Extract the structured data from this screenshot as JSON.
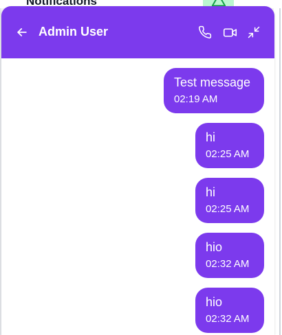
{
  "background": {
    "partial_heading": "Notifications"
  },
  "chat": {
    "title": "Admin User",
    "icons": {
      "back": "arrow-left-icon",
      "call": "phone-icon",
      "video": "video-icon",
      "minimize": "minimize-icon"
    },
    "accent_color": "#7c3aed",
    "messages": [
      {
        "text": "Test message",
        "time": "02:19 AM"
      },
      {
        "text": "hi",
        "time": "02:25 AM"
      },
      {
        "text": "hi",
        "time": "02:25 AM"
      },
      {
        "text": "hio",
        "time": "02:32 AM"
      },
      {
        "text": "hio",
        "time": "02:32 AM"
      }
    ]
  }
}
